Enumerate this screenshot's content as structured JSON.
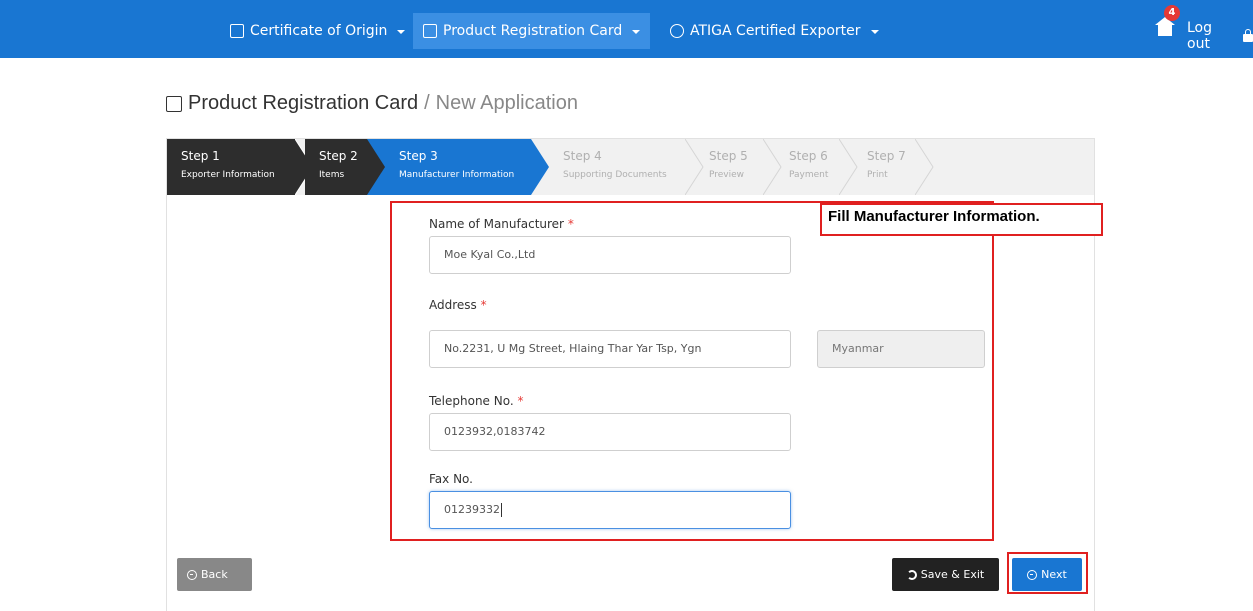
{
  "nav": {
    "item1": "Certificate of Origin",
    "item2": "Product Registration Card",
    "item3": "ATIGA Certified Exporter",
    "badge_count": "4",
    "logout": "Log out"
  },
  "title": {
    "main": "Product Registration Card",
    "separator": "/",
    "sub": "New Application"
  },
  "steps": [
    {
      "title": "Step 1",
      "sub": "Exporter Information"
    },
    {
      "title": "Step 2",
      "sub": "Items"
    },
    {
      "title": "Step 3",
      "sub": "Manufacturer Information"
    },
    {
      "title": "Step 4",
      "sub": "Supporting Documents"
    },
    {
      "title": "Step 5",
      "sub": "Preview"
    },
    {
      "title": "Step 6",
      "sub": "Payment"
    },
    {
      "title": "Step 7",
      "sub": "Print"
    }
  ],
  "callout": "Fill Manufacturer Information.",
  "form": {
    "manufacturer_label": "Name of Manufacturer",
    "manufacturer_value": "Moe Kyal Co.,Ltd",
    "address_label": "Address",
    "address_value": "No.2231, U Mg Street, Hlaing Thar Yar Tsp, Ygn",
    "country_value": "Myanmar",
    "telephone_label": "Telephone No.",
    "telephone_value": "0123932,0183742",
    "fax_label": "Fax No.",
    "fax_value": "01239332",
    "required_mark": "*"
  },
  "buttons": {
    "back": "Back",
    "save_exit": "Save & Exit",
    "next": "Next"
  },
  "colors": {
    "primary": "#1976d2",
    "dark": "#2d2d2d",
    "annotation": "#e02020"
  }
}
